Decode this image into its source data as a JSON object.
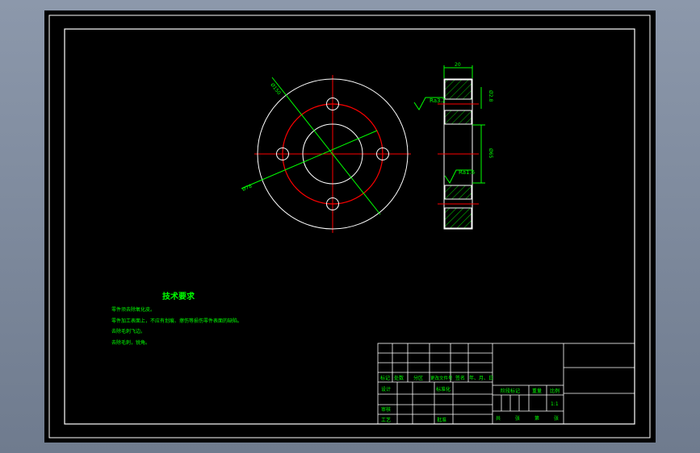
{
  "drawing": {
    "colors": {
      "background": "#000000",
      "outline": "#ffffff",
      "centerline": "#ff0000",
      "dimension": "#00ff00",
      "text": "#00ff00",
      "hatch": "#00ff00",
      "window_bg": "#7f8ba0"
    },
    "dims": {
      "outer_dia": "Ø150",
      "bolt_circle": "Ø78",
      "width": "20",
      "side_top": "Ø2.8",
      "side_mid": "Ø65",
      "rough1": "Ra3.2",
      "rough2": "Ra1.6"
    },
    "notes": {
      "title": "技术要求",
      "lines": [
        "零件须去除氧化皮。",
        "零件加工表面上，不应有划痕、擦伤等损伤零件表面的缺陷。",
        "去除毛刺飞边。",
        "去除毛刺，锐角。"
      ]
    },
    "title_block": {
      "header_row": [
        "标记",
        "处数",
        "分区",
        "更改文件号",
        "签名",
        "年、月、日"
      ],
      "design": "设计",
      "standardize": "标准化",
      "review": "审核",
      "process": "工艺",
      "approve": "批准",
      "stage_mark": "阶段标记",
      "weight": "重量",
      "scale": "比例",
      "scale_value": "1:1",
      "sheets_total": "共",
      "sheet_label": "张",
      "sheet_no": "第",
      "sheet_label2": "张"
    }
  }
}
